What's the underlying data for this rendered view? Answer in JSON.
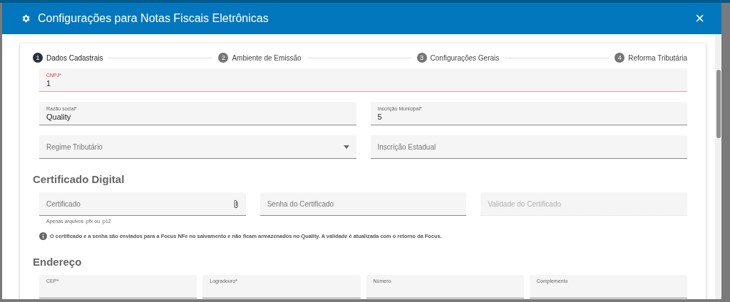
{
  "dialog": {
    "title": "Configurações para Notas Fiscais Eletrônicas",
    "close": "×"
  },
  "steps": [
    {
      "number": "1",
      "label": "Dados Cadastrais",
      "selected": true
    },
    {
      "number": "2",
      "label": "Ambiente de Emissão",
      "selected": false
    },
    {
      "number": "3",
      "label": "Configurações Gerais",
      "selected": false
    },
    {
      "number": "4",
      "label": "Reforma Tributária",
      "selected": false
    }
  ],
  "general_rows": [
    [
      {
        "kind": "text",
        "label": "CNPJ*",
        "value": "1",
        "error": true
      }
    ],
    [
      {
        "kind": "text",
        "label": "Razão social*",
        "value": "Quality",
        "error": false
      },
      {
        "kind": "text",
        "label": "Inscrição Municipal*",
        "value": "5",
        "error": false
      }
    ],
    [
      {
        "kind": "select",
        "placeholder": "Regime Tributário",
        "error": false
      },
      {
        "kind": "text",
        "placeholder": "Inscrição Estadual",
        "error": false
      }
    ]
  ],
  "certificate": {
    "title": "Certificado Digital",
    "fields": [
      {
        "kind": "file",
        "placeholder": "Certificado",
        "hint": "Apenas arquivos .pfx ou .p12",
        "disabled": false
      },
      {
        "kind": "text",
        "placeholder": "Senha do Certificado",
        "disabled": false
      },
      {
        "kind": "text",
        "placeholder": "Validade do Certificado",
        "disabled": true
      }
    ],
    "info": "O certificado e a senha são enviados para a Focus NFe no salvamento e não ficam armazenados no Quality. A validade é atualizada com o retorno da Focus."
  },
  "address": {
    "title": "Endereço",
    "fields": [
      {
        "label": "CEP*"
      },
      {
        "label": "Logradouro*"
      },
      {
        "label": "Número"
      },
      {
        "label": "Complemento"
      }
    ]
  }
}
